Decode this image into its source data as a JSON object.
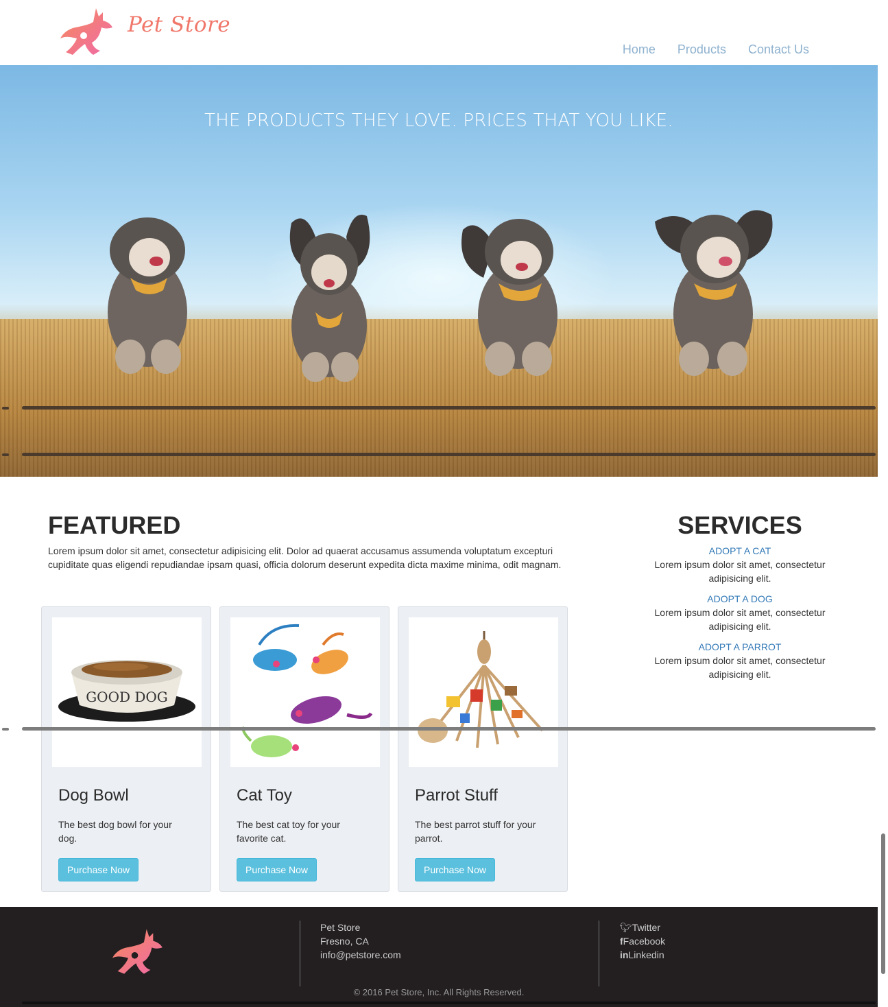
{
  "brand": {
    "name": "Pet Store",
    "logo_icon": "running-dog-icon",
    "colors": {
      "logo_gradient_start": "#f58a5c",
      "logo_gradient_end": "#f06aa8",
      "nav_link": "#8fb2cf",
      "button": "#5bc0de",
      "link": "#337ab7",
      "footer_bg": "#231f20"
    }
  },
  "nav": {
    "items": [
      {
        "label": "Home"
      },
      {
        "label": "Products"
      },
      {
        "label": "Contact Us"
      }
    ]
  },
  "hero": {
    "title": "THE PRODUCTS THEY LOVE. PRICES THAT YOU LIKE."
  },
  "featured": {
    "heading": "FEATURED",
    "intro": "Lorem ipsum dolor sit amet, consectetur adipisicing elit. Dolor ad quaerat accusamus assumenda voluptatum excepturi cupiditate quas eligendi repudiandae ipsam quasi, officia dolorum deserunt expedita dicta maxime minima, odit magnam.",
    "products": [
      {
        "title": "Dog Bowl",
        "description": "The best dog bowl for your dog.",
        "button": "Purchase Now",
        "image_text": "GOOD DOG"
      },
      {
        "title": "Cat Toy",
        "description": "The best cat toy for your favorite cat.",
        "button": "Purchase Now"
      },
      {
        "title": "Parrot Stuff",
        "description": "The best parrot stuff for your parrot.",
        "button": "Purchase Now"
      }
    ]
  },
  "services": {
    "heading": "SERVICES",
    "items": [
      {
        "link": "ADOPT A CAT",
        "text": "Lorem ipsum dolor sit amet, consectetur adipisicing elit."
      },
      {
        "link": "ADOPT A DOG",
        "text": "Lorem ipsum dolor sit amet, consectetur adipisicing elit."
      },
      {
        "link": "ADOPT A PARROT",
        "text": "Lorem ipsum dolor sit amet, consectetur adipisicing elit."
      }
    ]
  },
  "footer": {
    "contact": [
      "Pet Store",
      "Fresno, CA",
      "info@petstore.com"
    ],
    "social": [
      {
        "icon": "twitter-icon",
        "label": "Twitter"
      },
      {
        "icon": "facebook-icon",
        "label": "Facebook"
      },
      {
        "icon": "linkedin-icon",
        "label": "Linkedin"
      }
    ],
    "copyright": "© 2016 Pet Store, Inc. All Rights Reserved."
  }
}
